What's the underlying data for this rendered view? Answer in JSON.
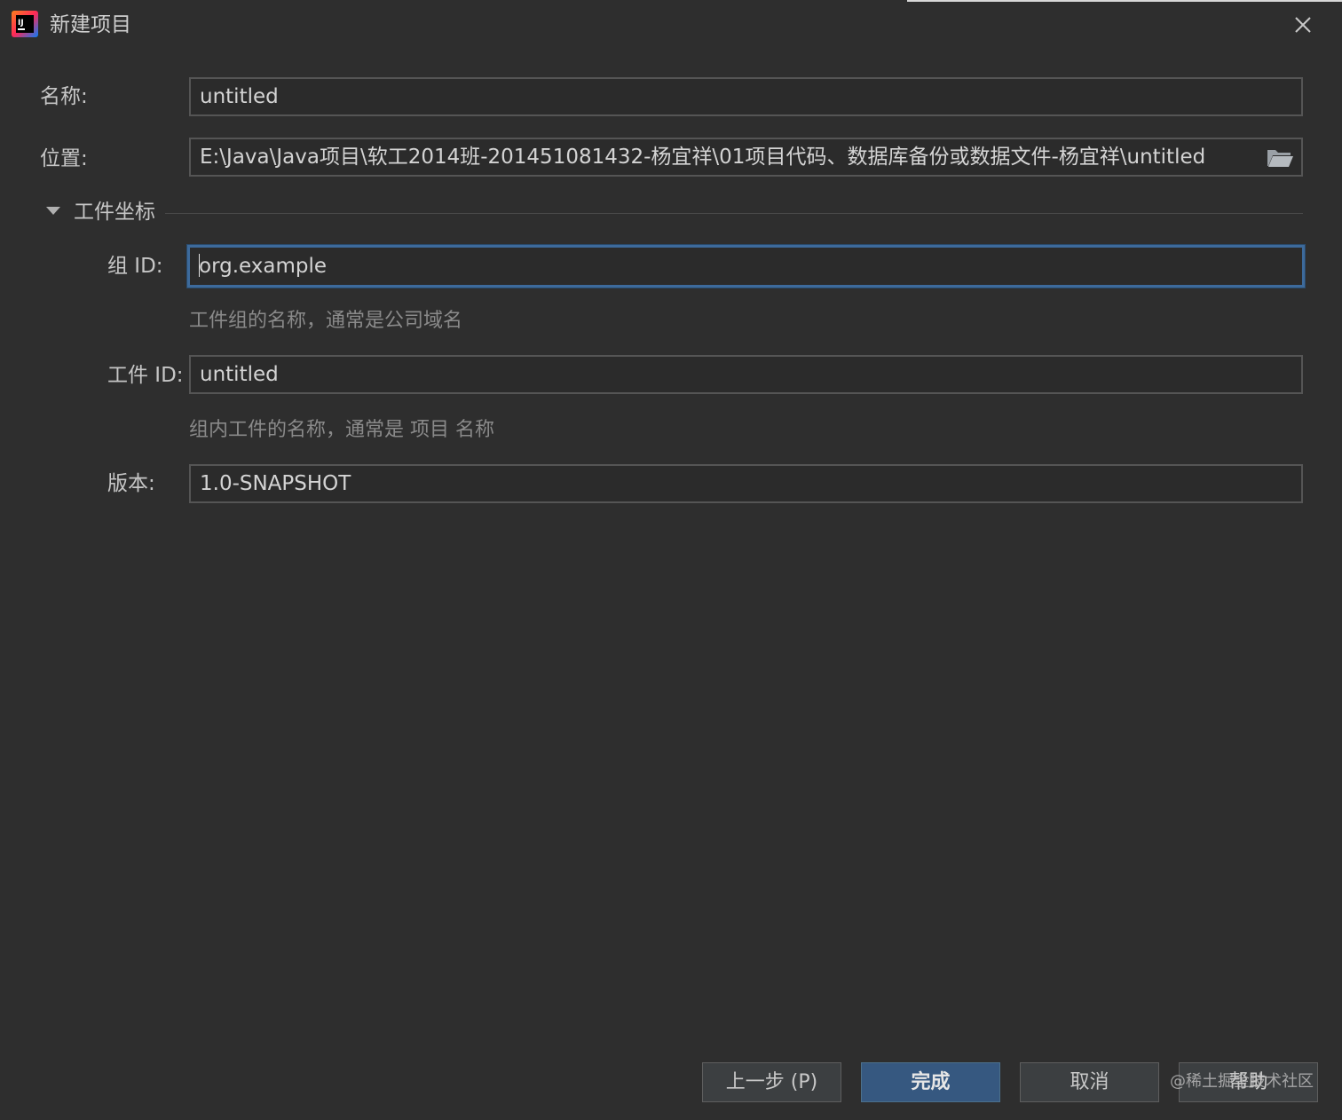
{
  "window": {
    "title": "新建项目"
  },
  "form": {
    "name_label": "名称:",
    "name_value": "untitled",
    "location_label": "位置:",
    "location_value": "E:\\Java\\Java项目\\软工2014班-201451081432-杨宜祥\\01项目代码、数据库备份或数据文件-杨宜祥\\untitled"
  },
  "artifact_section": {
    "title": "工件坐标",
    "group_id_label": "组 ID:",
    "group_id_value": "org.example",
    "group_id_hint": "工件组的名称，通常是公司域名",
    "artifact_id_label": "工件 ID:",
    "artifact_id_value": "untitled",
    "artifact_id_hint": "组内工件的名称，通常是 项目 名称",
    "version_label": "版本:",
    "version_value": "1.0-SNAPSHOT"
  },
  "buttons": {
    "previous": "上一步 (P)",
    "finish": "完成",
    "cancel": "取消",
    "help": "帮助"
  },
  "watermark": "@稀土掘金技术社区",
  "icons": {
    "app": "intellij-idea-icon",
    "close": "close-icon",
    "folder": "folder-open-icon",
    "toggle": "triangle-down-icon"
  },
  "colors": {
    "background": "#2e2e2e",
    "focus_border": "#3d6a9b",
    "primary_button": "#365880"
  }
}
